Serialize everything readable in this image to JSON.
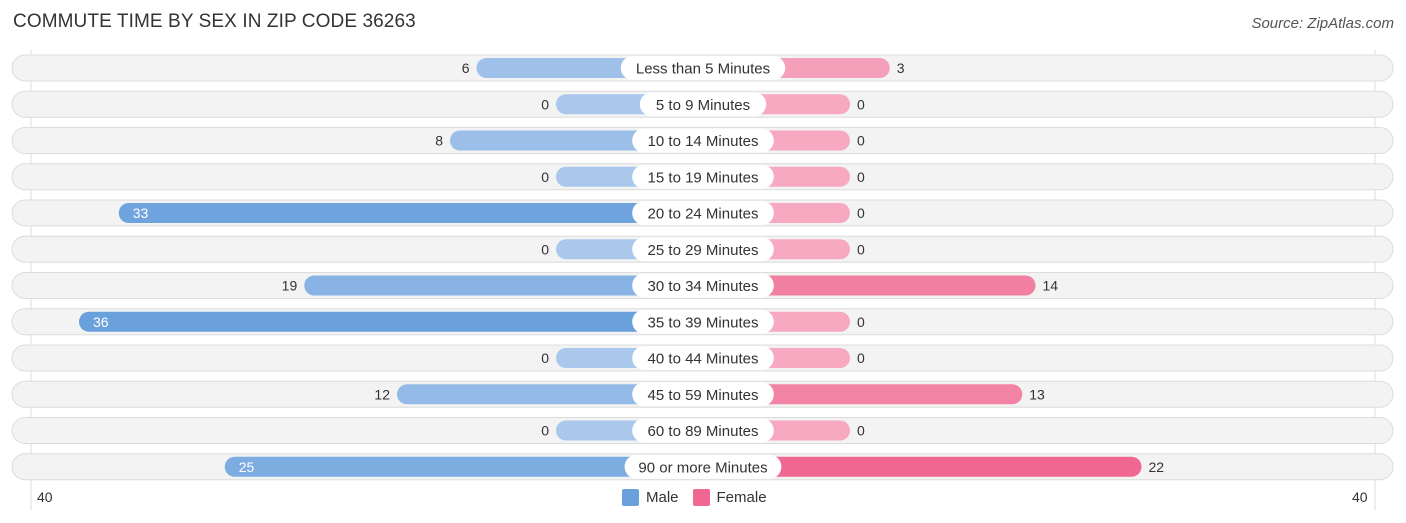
{
  "header": {
    "title": "COMMUTE TIME BY SEX IN ZIP CODE 36263",
    "source": "Source: ZipAtlas.com"
  },
  "colors": {
    "male": "#6aa0dc",
    "male_light": "#a9c8ec",
    "female": "#f06892",
    "female_light": "#f6a9c1",
    "row_bg": "#f3f3f3"
  },
  "chart_data": {
    "type": "bar",
    "orientation": "horizontal-diverging",
    "title": "COMMUTE TIME BY SEX IN ZIP CODE 36263",
    "categories": [
      "Less than 5 Minutes",
      "5 to 9 Minutes",
      "10 to 14 Minutes",
      "15 to 19 Minutes",
      "20 to 24 Minutes",
      "25 to 29 Minutes",
      "30 to 34 Minutes",
      "35 to 39 Minutes",
      "40 to 44 Minutes",
      "45 to 59 Minutes",
      "60 to 89 Minutes",
      "90 or more Minutes"
    ],
    "series": [
      {
        "name": "Male",
        "values": [
          6,
          0,
          8,
          0,
          33,
          0,
          19,
          36,
          0,
          12,
          0,
          25
        ]
      },
      {
        "name": "Female",
        "values": [
          3,
          0,
          0,
          0,
          0,
          0,
          14,
          0,
          0,
          13,
          0,
          22
        ]
      }
    ],
    "xlim": [
      -40,
      40
    ],
    "axis_labels": {
      "left": "40",
      "right": "40"
    },
    "legend": {
      "position": "bottom-center",
      "entries": [
        "Male",
        "Female"
      ]
    }
  }
}
